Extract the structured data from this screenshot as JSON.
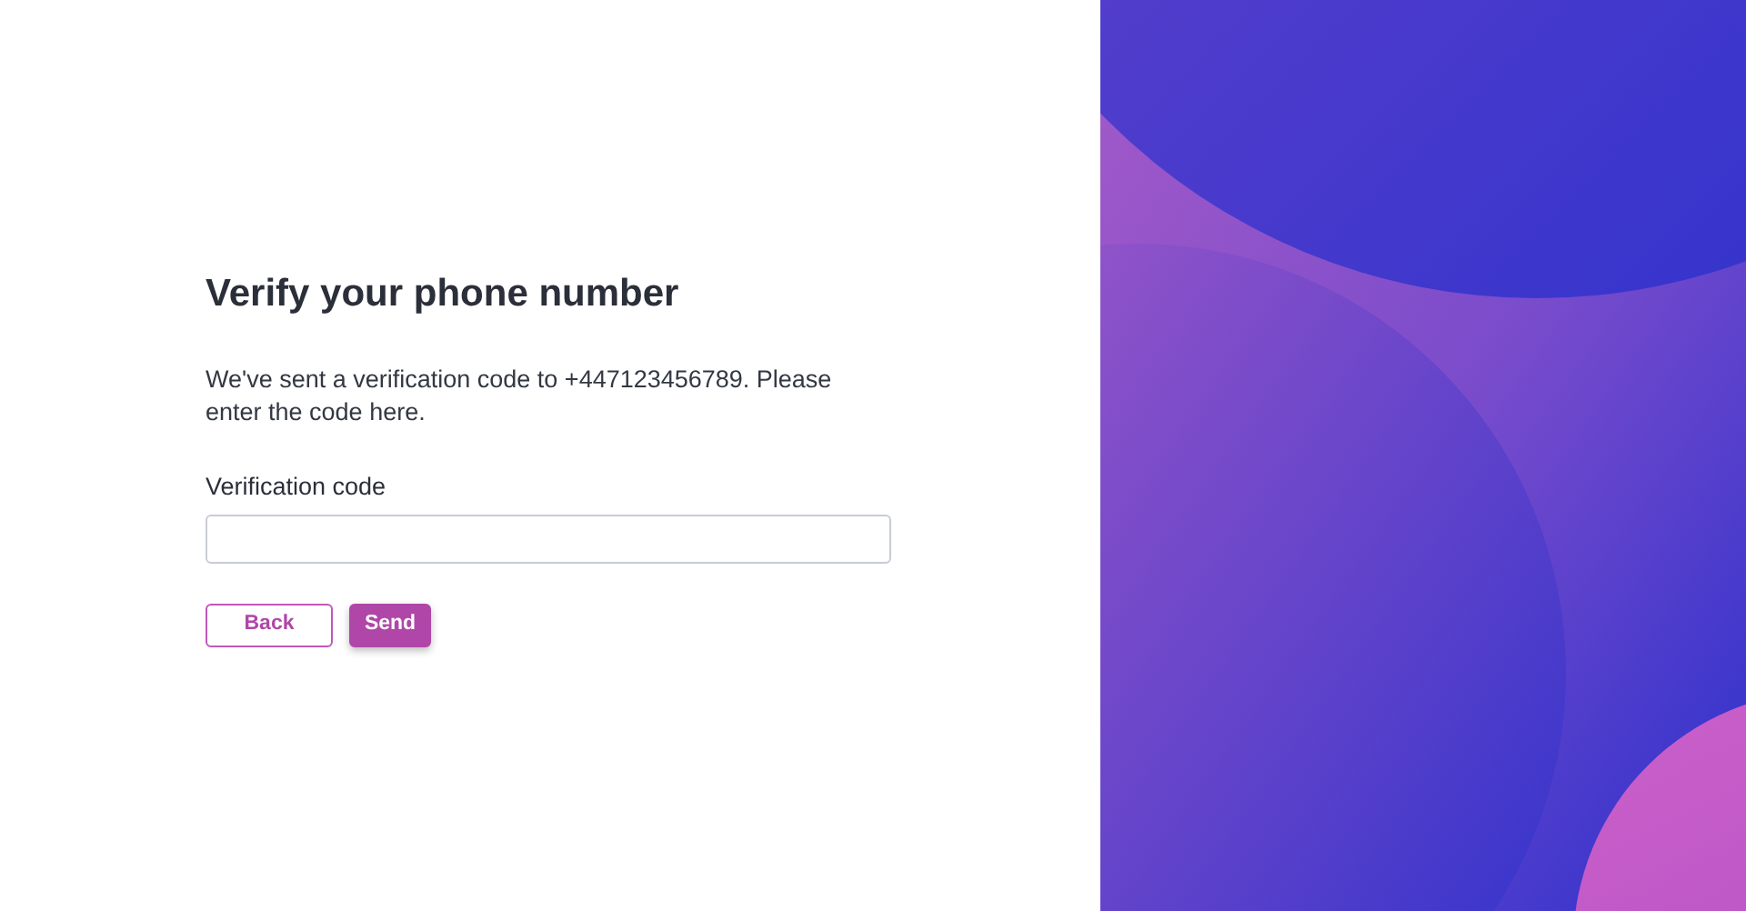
{
  "title": "Verify your phone number",
  "message": "We've sent a verification code to +447123456789. Please enter the code here.",
  "field": {
    "label": "Verification code"
  },
  "buttons": [
    {
      "label": "Back",
      "kind": "secondary"
    },
    {
      "label": "Send",
      "kind": "primary"
    }
  ]
}
